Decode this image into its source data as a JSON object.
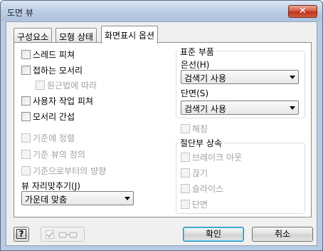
{
  "window": {
    "title": "도면 뷰",
    "close_glyph": "✕"
  },
  "tabs": [
    {
      "label": "구성요소"
    },
    {
      "label": "모형 상태"
    },
    {
      "label": "화면표시 옵션"
    }
  ],
  "options": {
    "section_edge": "스레드 피쳐",
    "tangent_edges": "접하는 모서리",
    "foreshortened": "원근법에 따라",
    "user_work_features": "사용자 작업 피쳐",
    "interference_edges": "모서리 간섭",
    "align_to_base": "기준에 정렬",
    "define_base_view": "기준 뷰의 정의",
    "direction_from_base": "기준으로부터의 방향",
    "view_justification_label": "뷰 자리맞추기(J)",
    "view_justification_value": "가운데 맞춤"
  },
  "standard_parts": {
    "group_label": "표준 부품",
    "hidden_line_label": "은선(H)",
    "hidden_line_value": "검색기 사용",
    "section_label": "단면(S)",
    "section_value": "검색기 사용"
  },
  "hatching": "해칭",
  "cut_inheritance": {
    "group_label": "절단부 상속",
    "break_out": "브레이크 아웃",
    "break": "끊기",
    "slice": "슬라이스",
    "section": "단면"
  },
  "footer": {
    "help_glyph": "?",
    "ok_label": "확인",
    "cancel_label": "취소"
  }
}
